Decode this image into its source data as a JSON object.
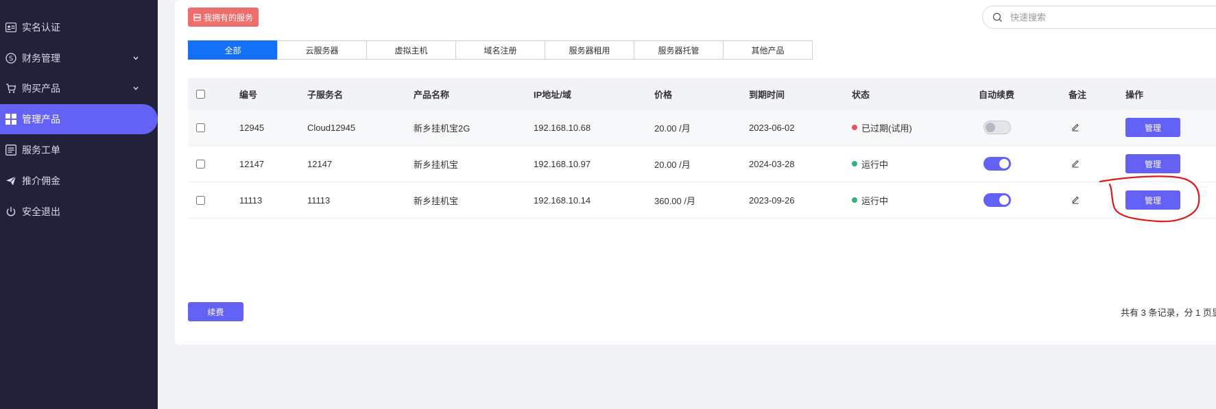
{
  "sidebar": {
    "items": [
      {
        "label": "实名认证",
        "icon": "id-card-icon"
      },
      {
        "label": "财务管理",
        "icon": "dollar-circle-icon"
      },
      {
        "label": "购买产品",
        "icon": "cart-icon"
      },
      {
        "label": "管理产品",
        "icon": "grid-icon"
      },
      {
        "label": "服务工单",
        "icon": "list-icon"
      },
      {
        "label": "推介佣金",
        "icon": "paper-plane-icon"
      },
      {
        "label": "安全退出",
        "icon": "power-icon"
      }
    ],
    "accent": "#6461f5"
  },
  "header": {
    "services_label": "我拥有的服务"
  },
  "search": {
    "placeholder": "快速搜索"
  },
  "tabs": [
    "全部",
    "云服务器",
    "虚拟主机",
    "域名注册",
    "服务器租用",
    "服务器托管",
    "其他产品"
  ],
  "table": {
    "headers": [
      "编号",
      "子服务名",
      "产品名称",
      "IP地址/域",
      "价格",
      "到期时间",
      "状态",
      "自动续费",
      "备注",
      "操作"
    ],
    "rows": [
      {
        "id": "12945",
        "sub": "Cloud12945",
        "product": "新乡挂机宝2G",
        "ip": "192.168.10.68",
        "price": "20.00 /月",
        "expire": "2023-06-02",
        "status": "已过期(试用)",
        "status_color": "#e8555f",
        "autorenew": false,
        "action": "管理"
      },
      {
        "id": "12147",
        "sub": "12147",
        "product": "新乡挂机宝",
        "ip": "192.168.10.97",
        "price": "20.00 /月",
        "expire": "2024-03-28",
        "status": "运行中",
        "status_color": "#2db57a",
        "autorenew": true,
        "action": "管理"
      },
      {
        "id": "11113",
        "sub": "11113",
        "product": "新乡挂机宝",
        "ip": "192.168.10.14",
        "price": "360.00 /月",
        "expire": "2023-09-26",
        "status": "运行中",
        "status_color": "#2db57a",
        "autorenew": true,
        "action": "管理"
      }
    ]
  },
  "footer": {
    "renew_label": "续费",
    "pagination": "共有 3 条记录，分 1 页显"
  },
  "colors": {
    "primary": "#6461f5",
    "tab_active": "#1470f5",
    "tag_red": "#ef6d6d",
    "annotation": "#e01818"
  }
}
